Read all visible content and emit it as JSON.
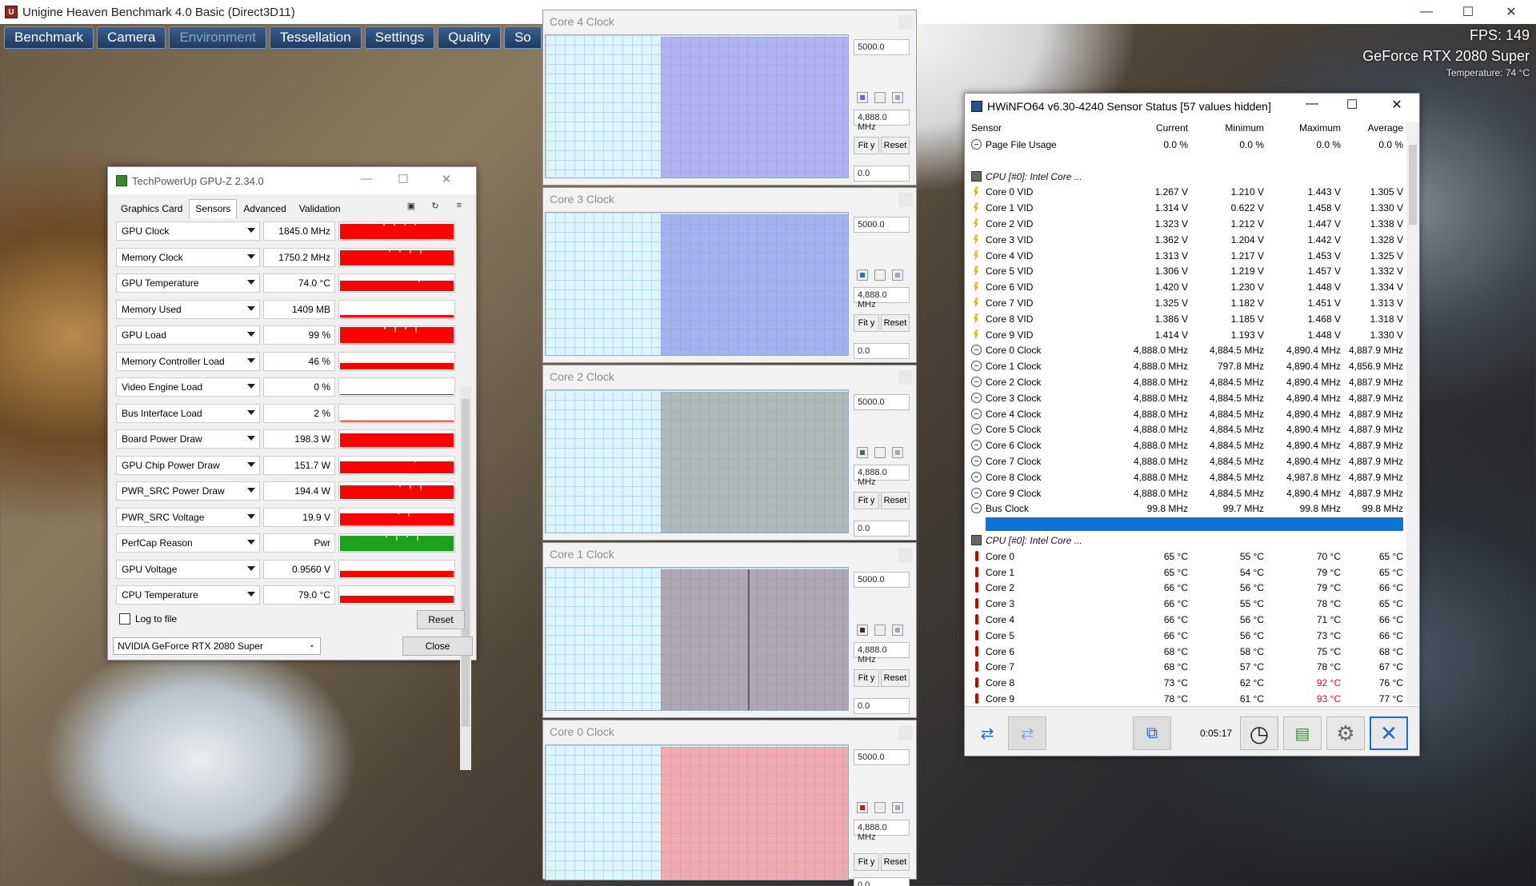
{
  "heaven": {
    "title": "Unigine Heaven Benchmark 4.0 Basic (Direct3D11)",
    "menu": [
      "Benchmark",
      "Camera",
      "Environment",
      "Tessellation",
      "Settings",
      "Quality",
      "So"
    ],
    "fps": "FPS: 149",
    "gpu": "GeForce RTX 2080 Super",
    "temperature": "Temperature: 74 °C",
    "controls": {
      "minimize": "—",
      "maximize": "☐",
      "close": "✕"
    }
  },
  "gpuz": {
    "title": "TechPowerUp GPU-Z 2.34.0",
    "tabs": [
      "Graphics Card",
      "Sensors",
      "Advanced",
      "Validation"
    ],
    "active_tab": "Sensors",
    "controls": {
      "minimize": "—",
      "maximize": "☐",
      "close": "✕"
    },
    "tab_icons": {
      "camera": "▣",
      "refresh": "↻",
      "menu": "≡"
    },
    "sensors": [
      {
        "name": "GPU Clock",
        "value": "1845.0 MHz",
        "level": 0.85,
        "color": "#ff0000"
      },
      {
        "name": "Memory Clock",
        "value": "1750.2 MHz",
        "level": 0.85,
        "color": "#ff0000"
      },
      {
        "name": "GPU Temperature",
        "value": "74.0 °C",
        "level": 0.6,
        "color": "#ff0000"
      },
      {
        "name": "Memory Used",
        "value": "1409 MB",
        "level": 0.12,
        "color": "#ff0000"
      },
      {
        "name": "GPU Load",
        "value": "99 %",
        "level": 0.9,
        "color": "#ff0000"
      },
      {
        "name": "Memory Controller Load",
        "value": "46 %",
        "level": 0.35,
        "color": "#ff0000"
      },
      {
        "name": "Video Engine Load",
        "value": "0 %",
        "level": 0,
        "color": "#ff0000"
      },
      {
        "name": "Bus Interface Load",
        "value": "2 %",
        "level": 0.04,
        "color": "#ff0000"
      },
      {
        "name": "Board Power Draw",
        "value": "198.3 W",
        "level": 0.75,
        "color": "#ff0000"
      },
      {
        "name": "GPU Chip Power Draw",
        "value": "151.7 W",
        "level": 0.7,
        "color": "#ff0000"
      },
      {
        "name": "PWR_SRC Power Draw",
        "value": "194.4 W",
        "level": 0.75,
        "color": "#ff0000"
      },
      {
        "name": "PWR_SRC Voltage",
        "value": "19.9 V",
        "level": 0.7,
        "color": "#ff0000"
      },
      {
        "name": "PerfCap Reason",
        "value": "Pwr",
        "level": 0.85,
        "color": "#1aa31a"
      },
      {
        "name": "GPU Voltage",
        "value": "0.9560 V",
        "level": 0.35,
        "color": "#ff0000"
      },
      {
        "name": "CPU Temperature",
        "value": "79.0 °C",
        "level": 0.4,
        "color": "#ff0000"
      }
    ],
    "log_to_file": "Log to file",
    "reset": "Reset",
    "device": "NVIDIA GeForce RTX 2080 Super",
    "close": "Close"
  },
  "core_graphs": [
    {
      "title": "Core 4 Clock",
      "max": "5000.0",
      "current": "4,888.0 MHz",
      "min": "0.0",
      "color": "#a9a9f0",
      "swatch": "#6a6ac8",
      "spike": null
    },
    {
      "title": "Core 3 Clock",
      "max": "5000.0",
      "current": "4,888.0 MHz",
      "min": "0.0",
      "color": "#9aa8ee",
      "swatch": "#3a6ab0",
      "spike": null
    },
    {
      "title": "Core 2 Clock",
      "max": "5000.0",
      "current": "4,888.0 MHz",
      "min": "0.0",
      "color": "#a8b0b0",
      "swatch": "#3a7060",
      "spike": null
    },
    {
      "title": "Core 1 Clock",
      "max": "5000.0",
      "current": "4,888.0 MHz",
      "min": "0.0",
      "color": "#a89aa8",
      "swatch": "#4a2a3a",
      "spike": 0.46
    },
    {
      "title": "Core 0 Clock",
      "max": "5000.0",
      "current": "4,888.0 MHz",
      "min": "0.0",
      "color": "#f2a0a4",
      "swatch": "#c81a1a",
      "spike": null
    }
  ],
  "graph_buttons": {
    "fit": "Fit y",
    "reset": "Reset"
  },
  "hwinfo": {
    "title": "HWiNFO64 v6.30-4240 Sensor Status [57 values hidden]",
    "controls": {
      "minimize": "—",
      "maximize": "☐",
      "close": "✕"
    },
    "columns": [
      "Sensor",
      "Current",
      "Minimum",
      "Maximum",
      "Average"
    ],
    "rows": [
      {
        "type": "sensor",
        "name": "Page File Usage",
        "cur": "0.0 %",
        "min": "0.0 %",
        "max": "0.0 %",
        "avg": "0.0 %"
      },
      {
        "type": "blank"
      },
      {
        "type": "group",
        "name": "CPU [#0]: Intel Core ..."
      },
      {
        "type": "volt",
        "name": "Core 0 VID",
        "cur": "1.267 V",
        "min": "1.210 V",
        "max": "1.443 V",
        "avg": "1.305 V"
      },
      {
        "type": "volt",
        "name": "Core 1 VID",
        "cur": "1.314 V",
        "min": "0.622 V",
        "max": "1.458 V",
        "avg": "1.330 V"
      },
      {
        "type": "volt",
        "name": "Core 2 VID",
        "cur": "1.323 V",
        "min": "1.212 V",
        "max": "1.447 V",
        "avg": "1.338 V"
      },
      {
        "type": "volt",
        "name": "Core 3 VID",
        "cur": "1.362 V",
        "min": "1.204 V",
        "max": "1.442 V",
        "avg": "1.328 V"
      },
      {
        "type": "volt",
        "name": "Core 4 VID",
        "cur": "1.313 V",
        "min": "1.217 V",
        "max": "1.453 V",
        "avg": "1.325 V"
      },
      {
        "type": "volt",
        "name": "Core 5 VID",
        "cur": "1.306 V",
        "min": "1.219 V",
        "max": "1.457 V",
        "avg": "1.332 V"
      },
      {
        "type": "volt",
        "name": "Core 6 VID",
        "cur": "1.420 V",
        "min": "1.230 V",
        "max": "1.448 V",
        "avg": "1.334 V"
      },
      {
        "type": "volt",
        "name": "Core 7 VID",
        "cur": "1.325 V",
        "min": "1.182 V",
        "max": "1.451 V",
        "avg": "1.313 V"
      },
      {
        "type": "volt",
        "name": "Core 8 VID",
        "cur": "1.386 V",
        "min": "1.185 V",
        "max": "1.468 V",
        "avg": "1.318 V"
      },
      {
        "type": "volt",
        "name": "Core 9 VID",
        "cur": "1.414 V",
        "min": "1.193 V",
        "max": "1.448 V",
        "avg": "1.330 V"
      },
      {
        "type": "sensor",
        "name": "Core 0 Clock",
        "cur": "4,888.0 MHz",
        "min": "4,884.5 MHz",
        "max": "4,890.4 MHz",
        "avg": "4,887.9 MHz"
      },
      {
        "type": "sensor",
        "name": "Core 1 Clock",
        "cur": "4,888.0 MHz",
        "min": "797.8 MHz",
        "max": "4,890.4 MHz",
        "avg": "4,856.9 MHz"
      },
      {
        "type": "sensor",
        "name": "Core 2 Clock",
        "cur": "4,888.0 MHz",
        "min": "4,884.5 MHz",
        "max": "4,890.4 MHz",
        "avg": "4,887.9 MHz"
      },
      {
        "type": "sensor",
        "name": "Core 3 Clock",
        "cur": "4,888.0 MHz",
        "min": "4,884.5 MHz",
        "max": "4,890.4 MHz",
        "avg": "4,887.9 MHz"
      },
      {
        "type": "sensor",
        "name": "Core 4 Clock",
        "cur": "4,888.0 MHz",
        "min": "4,884.5 MHz",
        "max": "4,890.4 MHz",
        "avg": "4,887.9 MHz"
      },
      {
        "type": "sensor",
        "name": "Core 5 Clock",
        "cur": "4,888.0 MHz",
        "min": "4,884.5 MHz",
        "max": "4,890.4 MHz",
        "avg": "4,887.9 MHz"
      },
      {
        "type": "sensor",
        "name": "Core 6 Clock",
        "cur": "4,888.0 MHz",
        "min": "4,884.5 MHz",
        "max": "4,890.4 MHz",
        "avg": "4,887.9 MHz"
      },
      {
        "type": "sensor",
        "name": "Core 7 Clock",
        "cur": "4,888.0 MHz",
        "min": "4,884.5 MHz",
        "max": "4,890.4 MHz",
        "avg": "4,887.9 MHz"
      },
      {
        "type": "sensor",
        "name": "Core 8 Clock",
        "cur": "4,888.0 MHz",
        "min": "4,884.5 MHz",
        "max": "4,987.8 MHz",
        "avg": "4,887.9 MHz"
      },
      {
        "type": "sensor",
        "name": "Core 9 Clock",
        "cur": "4,888.0 MHz",
        "min": "4,884.5 MHz",
        "max": "4,890.4 MHz",
        "avg": "4,887.9 MHz"
      },
      {
        "type": "sensor",
        "name": "Bus Clock",
        "cur": "99.8 MHz",
        "min": "99.7 MHz",
        "max": "99.8 MHz",
        "avg": "99.8 MHz"
      },
      {
        "type": "selected"
      },
      {
        "type": "group",
        "name": "CPU [#0]: Intel Core ..."
      },
      {
        "type": "temp",
        "name": "Core 0",
        "cur": "65 °C",
        "min": "55 °C",
        "max": "70 °C",
        "avg": "65 °C"
      },
      {
        "type": "temp",
        "name": "Core 1",
        "cur": "65 °C",
        "min": "54 °C",
        "max": "79 °C",
        "avg": "65 °C"
      },
      {
        "type": "temp",
        "name": "Core 2",
        "cur": "66 °C",
        "min": "56 °C",
        "max": "79 °C",
        "avg": "66 °C"
      },
      {
        "type": "temp",
        "name": "Core 3",
        "cur": "66 °C",
        "min": "55 °C",
        "max": "78 °C",
        "avg": "65 °C"
      },
      {
        "type": "temp",
        "name": "Core 4",
        "cur": "66 °C",
        "min": "56 °C",
        "max": "71 °C",
        "avg": "66 °C"
      },
      {
        "type": "temp",
        "name": "Core 5",
        "cur": "66 °C",
        "min": "56 °C",
        "max": "73 °C",
        "avg": "66 °C"
      },
      {
        "type": "temp",
        "name": "Core 6",
        "cur": "68 °C",
        "min": "58 °C",
        "max": "75 °C",
        "avg": "68 °C"
      },
      {
        "type": "temp",
        "name": "Core 7",
        "cur": "68 °C",
        "min": "57 °C",
        "max": "78 °C",
        "avg": "67 °C"
      },
      {
        "type": "temp",
        "name": "Core 8",
        "cur": "73 °C",
        "min": "62 °C",
        "max": "92 °C",
        "avg": "76 °C",
        "hot": true
      },
      {
        "type": "temp",
        "name": "Core 9",
        "cur": "78 °C",
        "min": "61 °C",
        "max": "93 °C",
        "avg": "77 °C",
        "hot": true
      }
    ],
    "elapsed": "0:05:17",
    "footer_icons": {
      "nav": "⇄",
      "nav_dim": "⇄",
      "network": "⧉",
      "clock": "◷",
      "report": "▤",
      "settings": "⚙",
      "close": "✕"
    }
  }
}
